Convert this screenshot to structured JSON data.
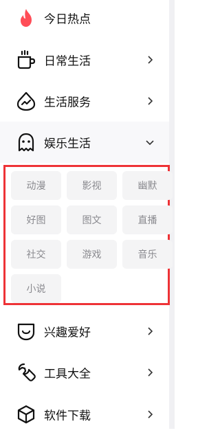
{
  "menu": {
    "hot": {
      "label": "今日热点",
      "icon": "flame-icon"
    },
    "daily": {
      "label": "日常生活",
      "icon": "cup-icon"
    },
    "services": {
      "label": "生活服务",
      "icon": "service-drop-icon"
    },
    "entertainment": {
      "label": "娱乐生活",
      "icon": "ghost-icon",
      "expanded": true
    },
    "hobby": {
      "label": "兴趣爱好",
      "icon": "smile-icon"
    },
    "tools": {
      "label": "工具大全",
      "icon": "wrench-icon"
    },
    "software": {
      "label": "软件下载",
      "icon": "box-icon"
    }
  },
  "submenu": {
    "items": [
      "动漫",
      "影视",
      "幽默",
      "好图",
      "图文",
      "直播",
      "社交",
      "游戏",
      "音乐",
      "小说"
    ]
  },
  "colors": {
    "accent_red": "#ee3236",
    "flame": "#ff4d57",
    "chip_bg": "#f4f4f5",
    "chip_text": "#8a8a8f"
  }
}
